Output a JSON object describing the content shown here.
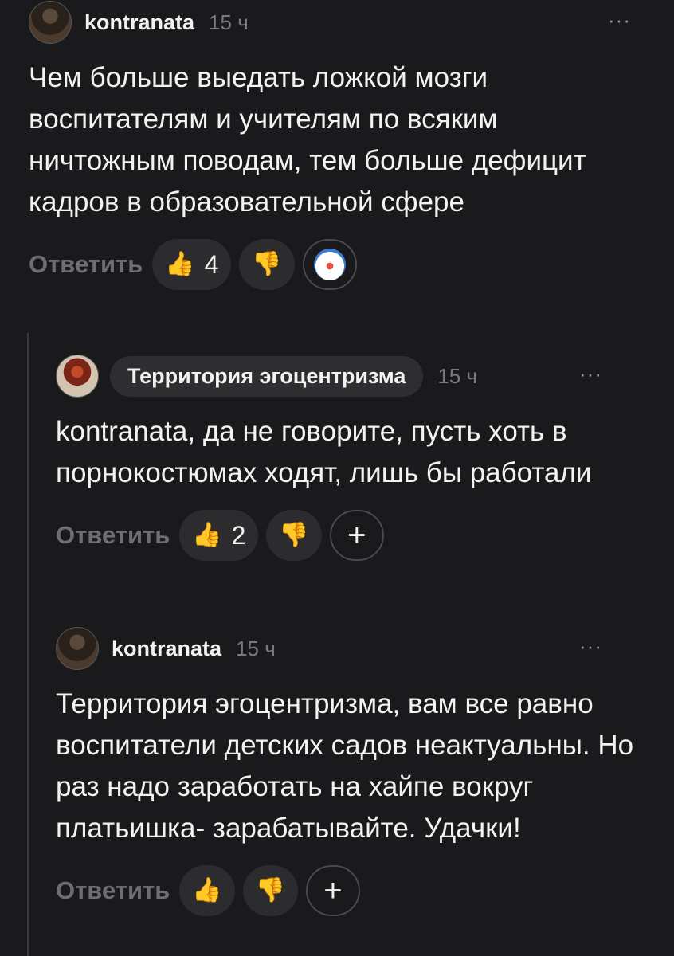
{
  "colors": {
    "background": "#1a1a1c",
    "text": "#f2f2f2",
    "muted": "#7a7a7e",
    "chip": "#2c2c2f"
  },
  "comments": [
    {
      "avatar_icon": "avatar-image",
      "user": "kontranata",
      "time": "15 ч",
      "more": "···",
      "text": "Чем больше выедать ложкой мозги воспитателям и учителям по всяким ничтожным поводам, тем больше дефицит кадров в образовательной сфере",
      "reply_label": "Ответить",
      "likes": "4",
      "like_icon": "thumbs-up-icon",
      "dislike_icon": "thumbs-down-icon",
      "extra_reaction_icon": "clown-face-icon"
    },
    {
      "avatar_icon": "avatar-image",
      "user": "Территория эгоцентризма",
      "time": "15 ч",
      "more": "···",
      "text": "kontranata, да не говорите, пусть хоть в порнокостюмах ходят, лишь бы работали",
      "reply_label": "Ответить",
      "likes": "2",
      "like_icon": "thumbs-up-icon",
      "dislike_icon": "thumbs-down-icon",
      "add_reaction": "+"
    },
    {
      "avatar_icon": "avatar-image",
      "user": "kontranata",
      "time": "15 ч",
      "more": "···",
      "text": "Территория эгоцентризма, вам все равно воспитатели детских садов неактуальны. Но раз надо заработать на хайпе вокруг платьишка- зарабатывайте. Удачки!",
      "reply_label": "Ответить",
      "like_icon": "thumbs-up-icon",
      "dislike_icon": "thumbs-down-icon",
      "add_reaction": "+"
    }
  ]
}
